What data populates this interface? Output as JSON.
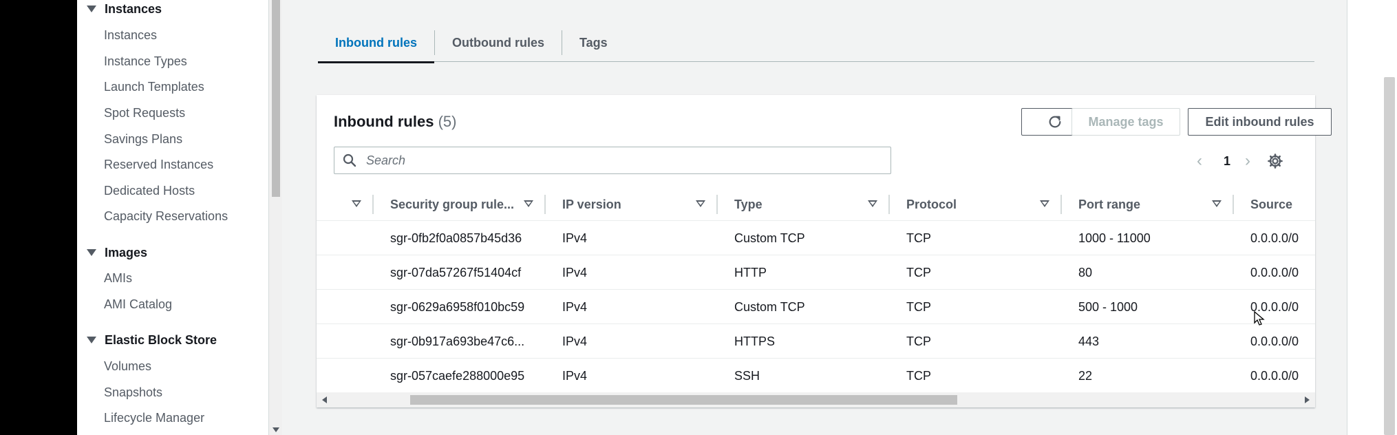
{
  "sidebar": {
    "sections": [
      {
        "label": "Instances",
        "items": [
          "Instances",
          "Instance Types",
          "Launch Templates",
          "Spot Requests",
          "Savings Plans",
          "Reserved Instances",
          "Dedicated Hosts",
          "Capacity Reservations"
        ]
      },
      {
        "label": "Images",
        "items": [
          "AMIs",
          "AMI Catalog"
        ]
      },
      {
        "label": "Elastic Block Store",
        "items": [
          "Volumes",
          "Snapshots",
          "Lifecycle Manager"
        ]
      }
    ]
  },
  "tabs": [
    {
      "label": "Inbound rules",
      "active": true
    },
    {
      "label": "Outbound rules",
      "active": false
    },
    {
      "label": "Tags",
      "active": false
    }
  ],
  "panel": {
    "title": "Inbound rules",
    "count": "(5)",
    "manage_tags_label": "Manage tags",
    "edit_rules_label": "Edit inbound rules",
    "search_placeholder": "Search",
    "page": "1"
  },
  "table": {
    "columns": [
      "Security group rule...",
      "IP version",
      "Type",
      "Protocol",
      "Port range",
      "Source"
    ],
    "rows": [
      [
        "sgr-0fb2f0a0857b45d36",
        "IPv4",
        "Custom TCP",
        "TCP",
        "1000 - 11000",
        "0.0.0.0/0"
      ],
      [
        "sgr-07da57267f51404cf",
        "IPv4",
        "HTTP",
        "TCP",
        "80",
        "0.0.0.0/0"
      ],
      [
        "sgr-0629a6958f010bc59",
        "IPv4",
        "Custom TCP",
        "TCP",
        "500 - 1000",
        "0.0.0.0/0"
      ],
      [
        "sgr-0b917a693be47c6...",
        "IPv4",
        "HTTPS",
        "TCP",
        "443",
        "0.0.0.0/0"
      ],
      [
        "sgr-057caefe288000e95",
        "IPv4",
        "SSH",
        "TCP",
        "22",
        "0.0.0.0/0"
      ]
    ]
  },
  "colors": {
    "accent": "#0073bb",
    "text": "#16191f",
    "muted": "#545b64",
    "background": "#f2f3f3"
  },
  "icons": [
    "caret-down-icon",
    "refresh-icon",
    "search-icon",
    "chevron-left-icon",
    "chevron-right-icon",
    "gear-icon",
    "sort-icon"
  ]
}
